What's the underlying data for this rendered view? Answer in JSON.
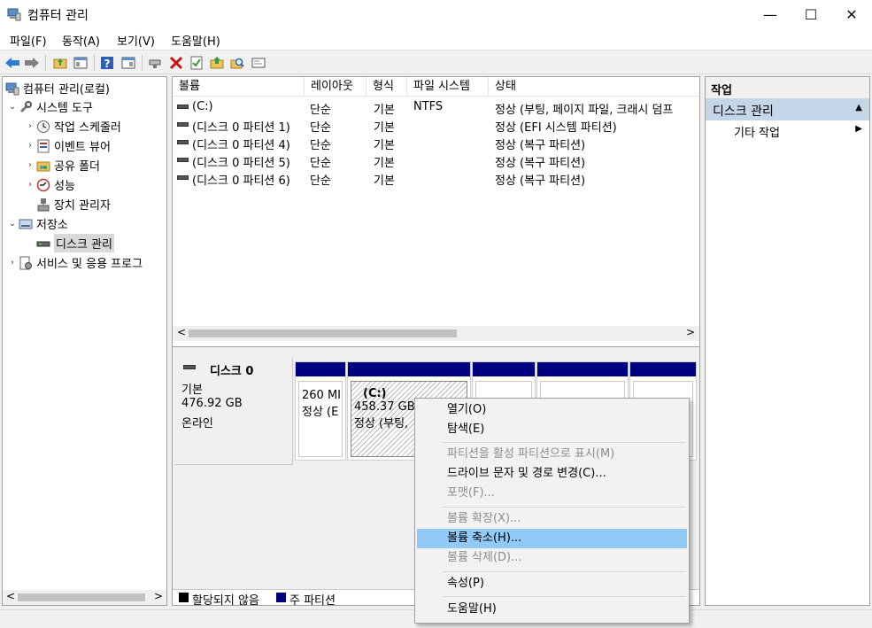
{
  "window": {
    "title": "컴퓨터 관리",
    "controls": {
      "minimize": "—",
      "maximize": "☐",
      "close": "✕"
    }
  },
  "menubar": [
    "파일(F)",
    "동작(A)",
    "보기(V)",
    "도움말(H)"
  ],
  "toolbar": {
    "icons": [
      "back-arrow-icon",
      "forward-arrow-icon",
      "folder-up-icon",
      "properties-pane-icon",
      "help-icon",
      "console-tree-icon",
      "connect-icon",
      "delete-icon",
      "checklist-icon",
      "folder-arrow-icon",
      "search-folder-icon",
      "monitor-icon"
    ]
  },
  "tree": {
    "root": "컴퓨터 관리(로컬)",
    "system_tools": "시스템 도구",
    "task_scheduler": "작업 스케줄러",
    "event_viewer": "이벤트 뷰어",
    "shared_folders": "공유 폴더",
    "performance": "성능",
    "device_manager": "장치 관리자",
    "storage": "저장소",
    "disk_management": "디스크 관리",
    "services": "서비스 및 응용 프로그"
  },
  "volume_list": {
    "headers": [
      "볼륨",
      "레이아웃",
      "형식",
      "파일 시스템",
      "상태"
    ],
    "rows": [
      {
        "volume": "(C:)",
        "layout": "단순",
        "type": "기본",
        "fs": "NTFS",
        "status": "정상 (부팅, 페이지 파일, 크래시 덤프"
      },
      {
        "volume": "(디스크 0 파티션 1)",
        "layout": "단순",
        "type": "기본",
        "fs": "",
        "status": "정상 (EFI 시스템 파티션)"
      },
      {
        "volume": "(디스크 0 파티션 4)",
        "layout": "단순",
        "type": "기본",
        "fs": "",
        "status": "정상 (복구 파티션)"
      },
      {
        "volume": "(디스크 0 파티션 5)",
        "layout": "단순",
        "type": "기본",
        "fs": "",
        "status": "정상 (복구 파티션)"
      },
      {
        "volume": "(디스크 0 파티션 6)",
        "layout": "단순",
        "type": "기본",
        "fs": "",
        "status": "정상 (복구 파티션)"
      }
    ],
    "scroll_left": "<",
    "scroll_right": ">"
  },
  "disk": {
    "name": "디스크 0",
    "type": "기본",
    "size": "476.92 GB",
    "state": "온라인",
    "partitions": [
      {
        "line1": "260 MI",
        "line2": "정상 (E"
      },
      {
        "line1": "(C:)",
        "line2": "458.37 GB",
        "line3": "정상 (부팅,"
      },
      {
        "line1": "",
        "line2": ""
      },
      {
        "line1": "",
        "line2": ""
      },
      {
        "line1": "",
        "line2": ""
      }
    ]
  },
  "legend": [
    {
      "label": "할당되지 않음",
      "color": "#000000"
    },
    {
      "label": "주 파티션",
      "color": "#000080"
    }
  ],
  "actions": {
    "header": "작업",
    "section": "디스크 관리",
    "more": "기타 작업"
  },
  "context_menu": {
    "items": [
      {
        "label": "열기(O)",
        "enabled": true
      },
      {
        "label": "탐색(E)",
        "enabled": true
      },
      {
        "label": "파티션을 활성 파티션으로 표시(M)",
        "enabled": false
      },
      {
        "label": "드라이브 문자 및 경로 변경(C)...",
        "enabled": true
      },
      {
        "label": "포맷(F)...",
        "enabled": false
      },
      {
        "label": "볼륨 확장(X)...",
        "enabled": false
      },
      {
        "label": "볼륨 축소(H)...",
        "enabled": true,
        "highlighted": true
      },
      {
        "label": "볼륨 삭제(D)...",
        "enabled": false
      },
      {
        "label": "속성(P)",
        "enabled": true
      },
      {
        "label": "도움말(H)",
        "enabled": true
      }
    ]
  }
}
